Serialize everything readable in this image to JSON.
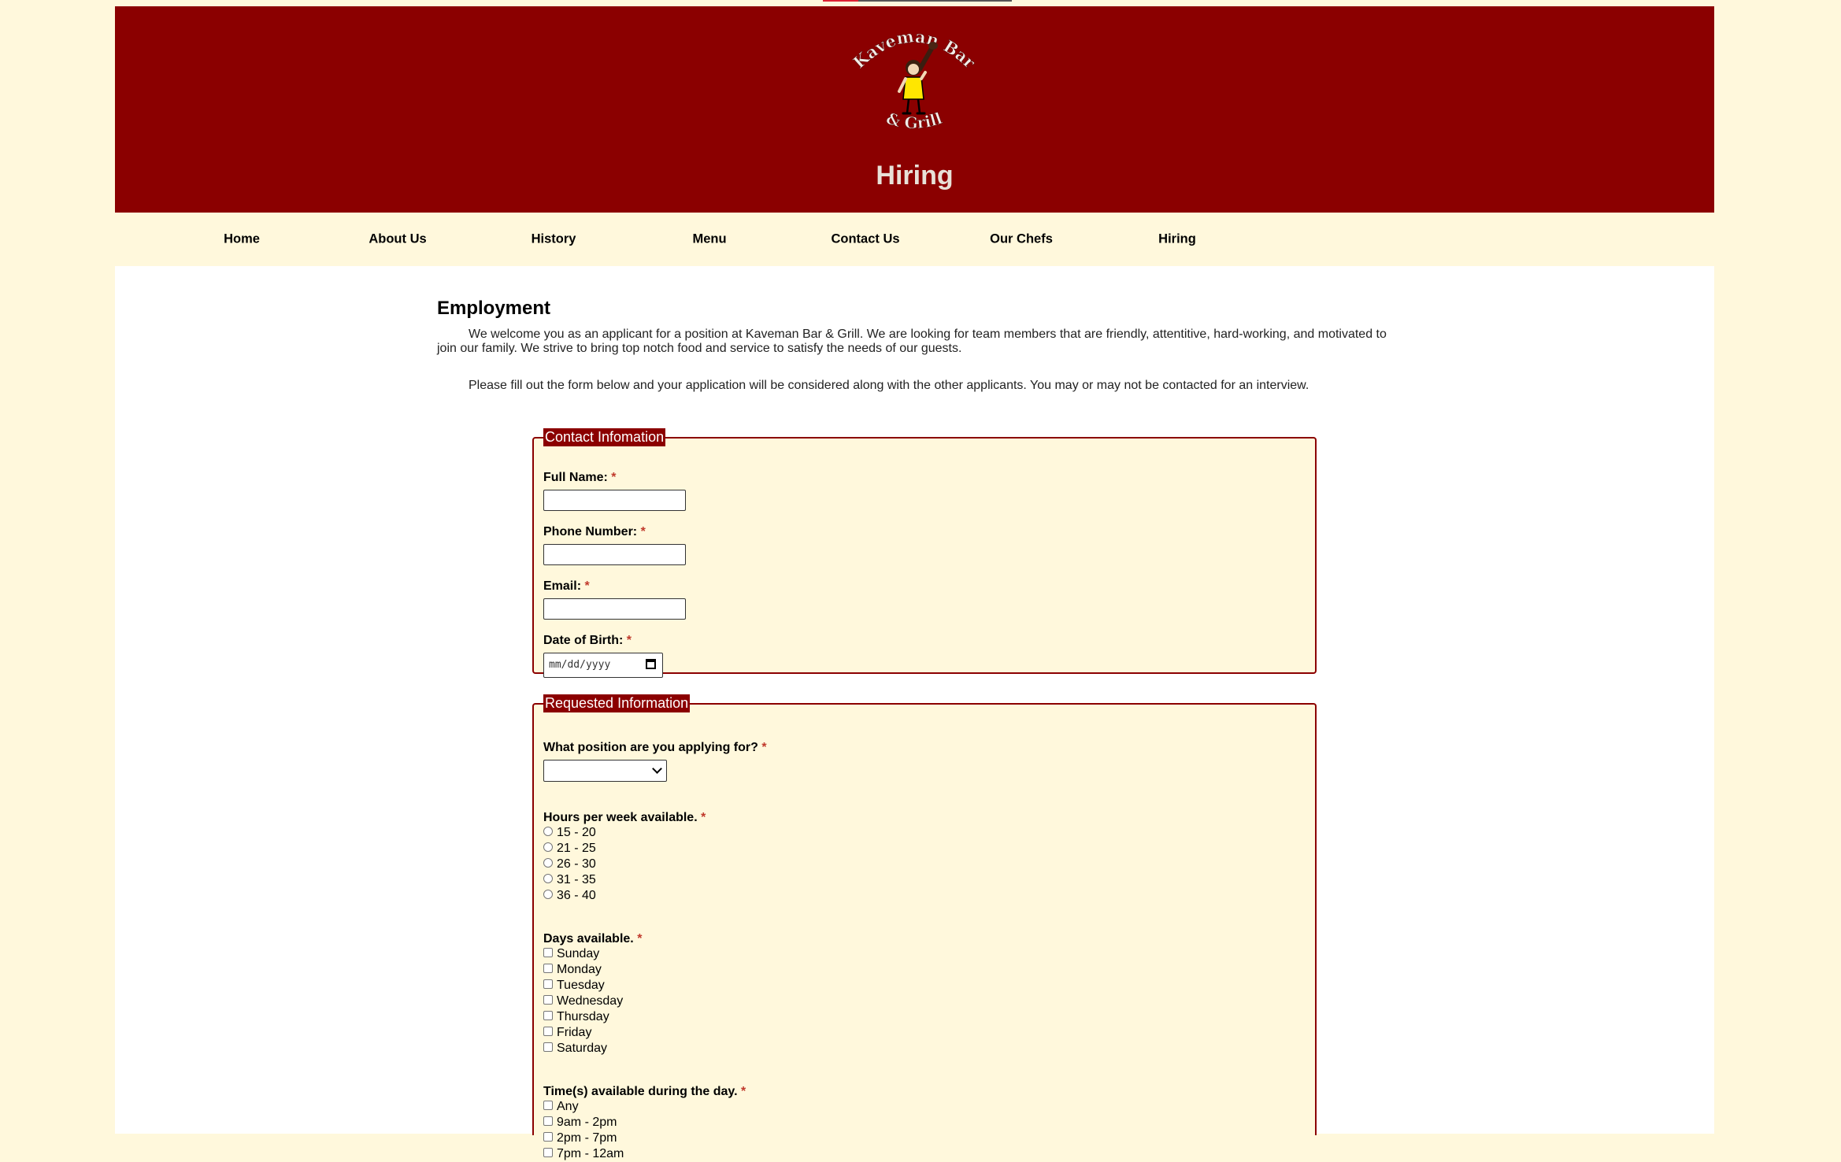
{
  "site": {
    "logo_text_top": "Kaveman Bar",
    "logo_text_bottom": "& Grill",
    "banner_title": "Hiring"
  },
  "nav": [
    "Home",
    "About Us",
    "History",
    "Menu",
    "Contact Us",
    "Our Chefs",
    "Hiring"
  ],
  "main": {
    "heading": "Employment",
    "intro": "We welcome you as an applicant for a position at Kaveman Bar & Grill. We are looking for team members that are friendly, attentitive, hard-working, and motivated to join our family. We strive to bring top notch food and service to satisfy the needs of our guests.",
    "instructions": "Please fill out the form below and your application will be considered along with the other applicants. You may or may not be contacted for an interview."
  },
  "contact": {
    "legend": "Contact Infomation",
    "full_name": "Full Name:",
    "phone": "Phone Number:",
    "email": "Email:",
    "dob": "Date of Birth:",
    "dob_placeholder": "mm/dd/yyyy",
    "required_mark": "*"
  },
  "requested": {
    "legend": "Requested Information",
    "position": "What position are you applying for?",
    "position_selected": "",
    "hours": "Hours per week available.",
    "hours_options": [
      "15 - 20",
      "21 - 25",
      "26 - 30",
      "31 - 35",
      "36 - 40"
    ],
    "days": "Days available.",
    "days_options": [
      "Sunday",
      "Monday",
      "Tuesday",
      "Wednesday",
      "Thursday",
      "Friday",
      "Saturday"
    ],
    "times": "Time(s) available during the day.",
    "times_options": [
      "Any",
      "9am - 2pm",
      "2pm - 7pm",
      "7pm - 12am"
    ]
  },
  "colors": {
    "brand": "#8b0000",
    "page_bg": "#fff8dc",
    "required": "#c0392b"
  }
}
